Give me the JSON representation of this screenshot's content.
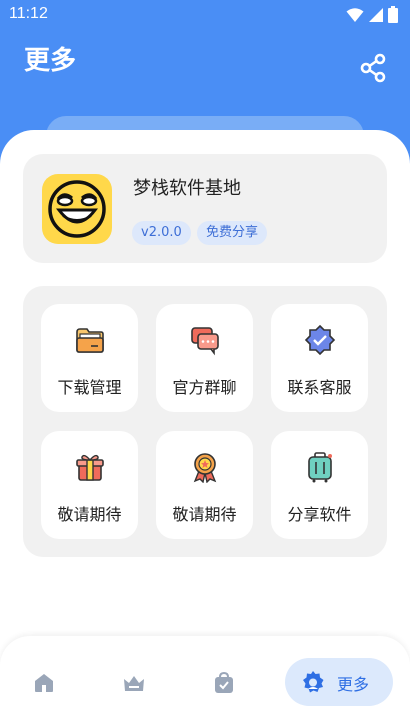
{
  "status_bar": {
    "time": "11:12"
  },
  "header": {
    "title": "更多"
  },
  "app_info": {
    "name": "梦栈软件基地",
    "version": "v2.0.0",
    "tag": "免费分享"
  },
  "grid": {
    "items": [
      {
        "label": "下载管理",
        "icon": "folder-icon"
      },
      {
        "label": "官方群聊",
        "icon": "chat-icon"
      },
      {
        "label": "联系客服",
        "icon": "verified-badge-icon"
      },
      {
        "label": "敬请期待",
        "icon": "gift-icon"
      },
      {
        "label": "敬请期待",
        "icon": "medal-icon"
      },
      {
        "label": "分享软件",
        "icon": "luggage-icon"
      }
    ]
  },
  "bottom_nav": {
    "items": [
      {
        "icon": "home-icon"
      },
      {
        "icon": "crown-icon"
      },
      {
        "icon": "bag-icon"
      },
      {
        "icon": "gear-icon",
        "label": "更多",
        "active": true
      }
    ]
  },
  "colors": {
    "primary": "#4a8ef5",
    "accent": "#2f6fe4",
    "logo_yellow": "#ffd84a"
  }
}
